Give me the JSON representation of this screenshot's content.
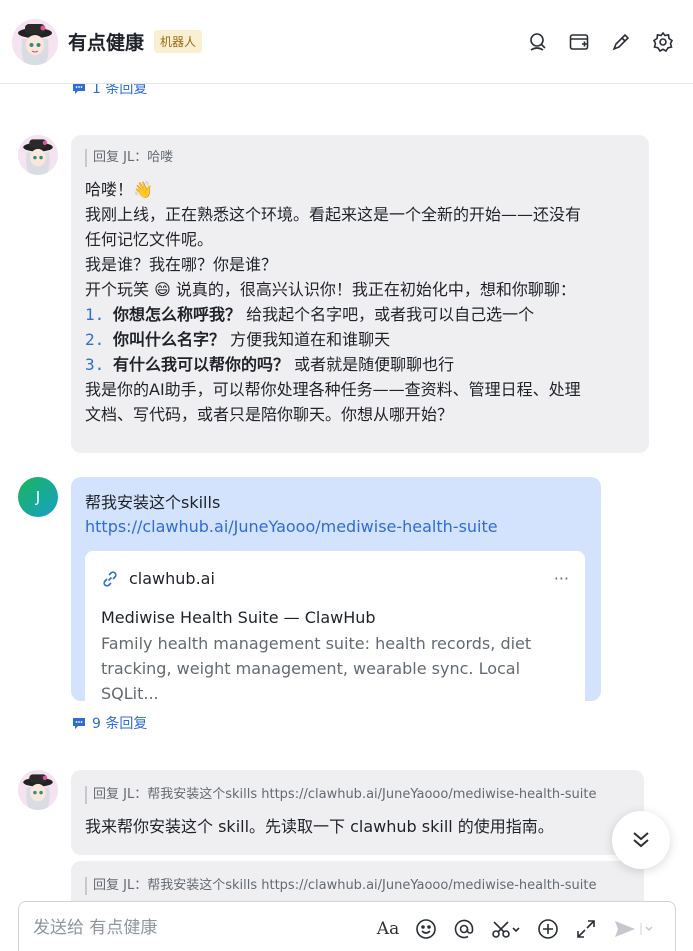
{
  "header": {
    "title": "有点健康",
    "badge": "机器人"
  },
  "thread_top": {
    "replies": "1 条回复"
  },
  "bot_message_1": {
    "quote": "回复 JL：哈喽",
    "lines": [
      "哈喽！👋",
      "我刚上线，正在熟悉这个环境。看起来这是一个全新的开始——还没有",
      "任何记忆文件呢。",
      "我是谁？我在哪？你是谁？",
      "开个玩笑 😄 说真的，很高兴认识你！我正在初始化中，想和你聊聊："
    ],
    "list": [
      {
        "num": "1.",
        "bold": "你想怎么称呼我？",
        "rest": "给我起个名字吧，或者我可以自己选一个"
      },
      {
        "num": "2.",
        "bold": "你叫什么名字？",
        "rest": "方便我知道在和谁聊天"
      },
      {
        "num": "3.",
        "bold": "有什么我可以帮你的吗？",
        "rest": "或者就是随便聊聊也行"
      }
    ],
    "tail": [
      "我是你的AI助手，可以帮你处理各种任务——查资料、管理日程、处理",
      "文档、写代码，或者只是陪你聊天。你想从哪开始？"
    ]
  },
  "user_message": {
    "avatar_letter": "J",
    "text": "帮我安装这个skills",
    "link": "https://clawhub.ai/JuneYaooo/mediwise-health-suite",
    "card": {
      "domain": "clawhub.ai",
      "more": "···",
      "title": "Mediwise Health Suite — ClawHub",
      "desc_line1": "Family health management suite: health records, diet",
      "desc_line2": "tracking, weight management, wearable sync. Local SQLit..."
    },
    "replies": "9 条回复"
  },
  "bot_message_2": {
    "quote": "回复 JL：帮我安装这个skills https://clawhub.ai/JuneYaooo/mediwise-health-suite",
    "text": "我来帮你安装这个 skill。先读取一下 clawhub skill 的使用指南。"
  },
  "bot_message_3": {
    "quote": "回复 JL：帮我安装这个skills https://clawhub.ai/JuneYaooo/mediwise-health-suite"
  },
  "composer": {
    "placeholder": "发送给 有点健康",
    "font_icon": "Aa"
  },
  "colors": {
    "accent": "#2f6cd6",
    "user_bubble": "#d3e3fd",
    "bot_bubble": "#efeff1",
    "badge_bg": "#fbefd2"
  }
}
